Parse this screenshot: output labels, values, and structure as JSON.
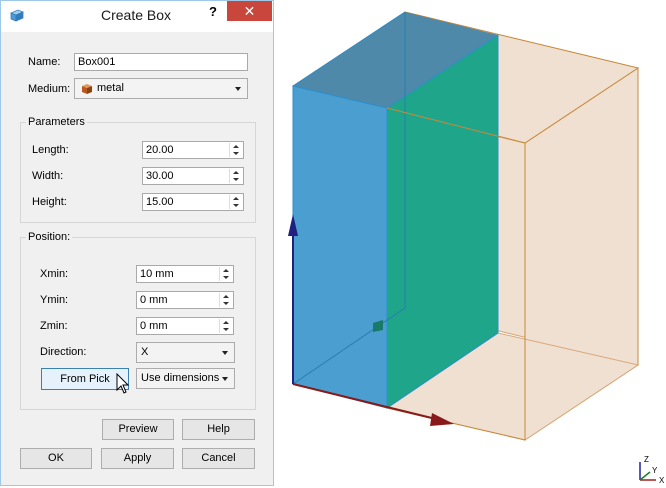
{
  "window": {
    "title": "Create Box",
    "help_label": "?",
    "close_label": "✕"
  },
  "form": {
    "name_label": "Name:",
    "name_value": "Box001",
    "medium_label": "Medium:",
    "medium_value": "metal",
    "medium_icon": "box-material-icon"
  },
  "parameters": {
    "title": "Parameters",
    "length_label": "Length:",
    "length_value": "20.00",
    "width_label": "Width:",
    "width_value": "30.00",
    "height_label": "Height:",
    "height_value": "15.00"
  },
  "position": {
    "title": "Position:",
    "xmin_label": "Xmin:",
    "xmin_value": "10 mm",
    "ymin_label": "Ymin:",
    "ymin_value": "0 mm",
    "zmin_label": "Zmin:",
    "zmin_value": "0 mm",
    "direction_label": "Direction:",
    "direction_value": "X",
    "from_pick_label": "From Pick",
    "mode_value": "Use dimensions"
  },
  "buttons": {
    "preview": "Preview",
    "help": "Help",
    "ok": "OK",
    "apply": "Apply",
    "cancel": "Cancel"
  },
  "axes": {
    "z": "Z",
    "y": "Y",
    "x": "X"
  },
  "colors": {
    "accent_close": "#c9463d",
    "face_blue": "#4a9fd0",
    "face_green": "#1fa58a",
    "box_peach": "#efe0d2",
    "edge_orange": "#c8893a",
    "axis_blue": "#202080",
    "axis_red": "#8a1a1a"
  }
}
